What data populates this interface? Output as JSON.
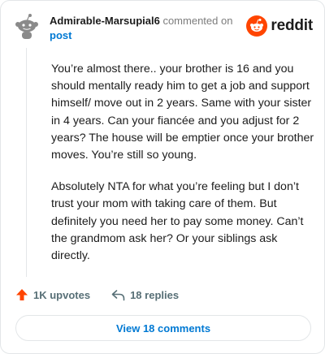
{
  "comment": {
    "username": "Admirable-Marsupial6",
    "action_text": "commented on",
    "post_link_label": "post",
    "paragraphs": [
      "You’re almost there.. your brother is 16 and you should mentally ready him to get a job and support himself/ move out in 2 years. Same with your sister in 4 years. Can your fiancée and you adjust for 2 years? The house will be emptier once your brother moves. You’re still so young.",
      "Absolutely NTA for what you’re feeling but I don’t trust your mom with taking care of them. But definitely you need her to pay some money. Can’t the grandmom ask her? Or your siblings ask directly."
    ]
  },
  "brand": {
    "name": "reddit",
    "color": "#ff4500",
    "icon": "reddit-logo-icon"
  },
  "stats": {
    "upvotes_label": "1K upvotes",
    "replies_label": "18 replies",
    "upvote_color": "#ff4500"
  },
  "view_comments_label": "View 18 comments",
  "colors": {
    "link": "#0079d3",
    "muted": "#576f76",
    "border": "#e3e6e8"
  }
}
